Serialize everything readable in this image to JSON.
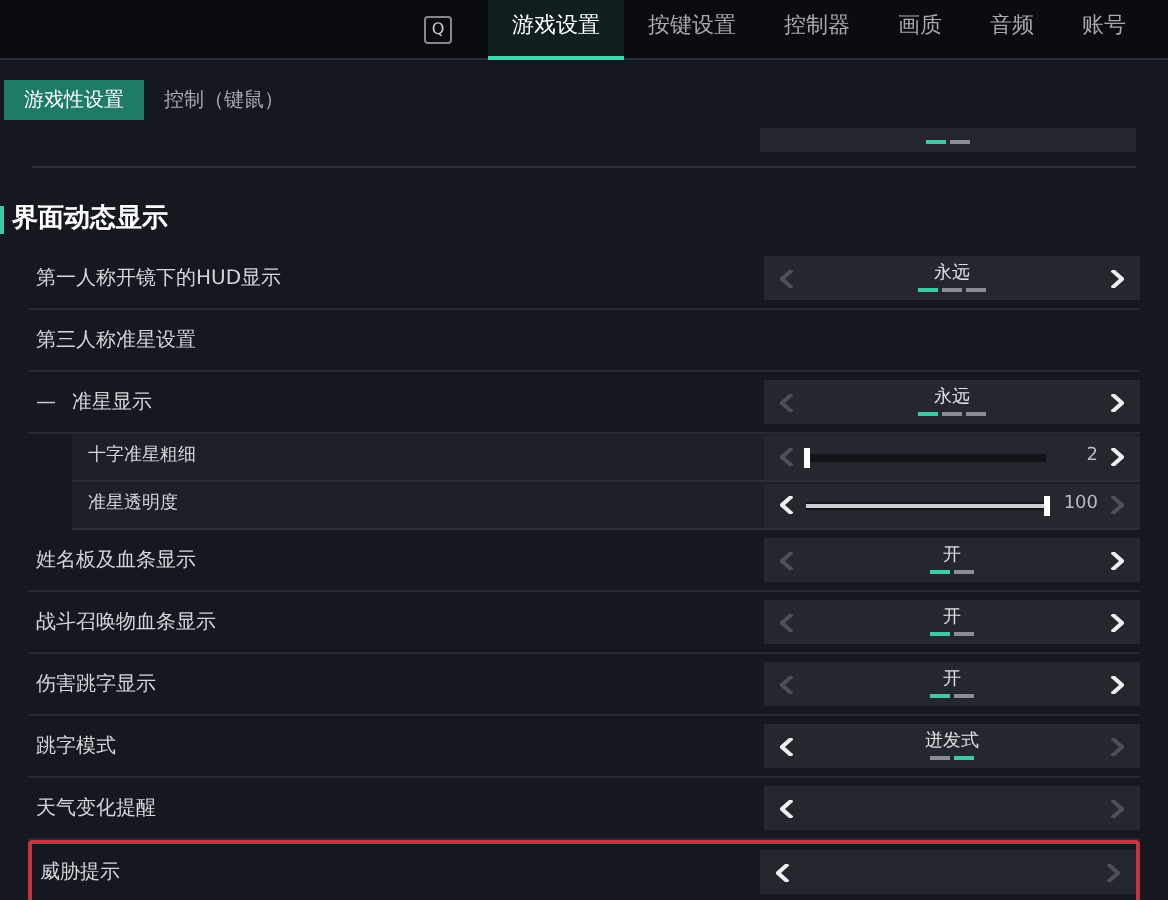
{
  "top_nav": {
    "left_key": "Q",
    "tabs": [
      {
        "label": "游戏设置",
        "selected": true
      },
      {
        "label": "按键设置",
        "selected": false
      },
      {
        "label": "控制器",
        "selected": false
      },
      {
        "label": "画质",
        "selected": false
      },
      {
        "label": "音频",
        "selected": false
      },
      {
        "label": "账号",
        "selected": false
      }
    ]
  },
  "sub_tabs": [
    {
      "label": "游戏性设置",
      "selected": true
    },
    {
      "label": "控制（键鼠）",
      "selected": false
    }
  ],
  "partial_row": {
    "segments": [
      {
        "selected": true
      },
      {
        "selected": false
      }
    ]
  },
  "section": {
    "title": "界面动态显示"
  },
  "rows": [
    {
      "kind": "selector",
      "label": "第一人称开镜下的HUD显示",
      "value": "永远",
      "prev_enabled": false,
      "next_enabled": true,
      "segments": [
        {
          "selected": true
        },
        {
          "selected": false
        },
        {
          "selected": false
        }
      ]
    },
    {
      "kind": "heading",
      "label": "第三人称准星设置"
    },
    {
      "kind": "selector",
      "label": "准星显示",
      "prefix": "—",
      "value": "永远",
      "prev_enabled": false,
      "next_enabled": true,
      "segments": [
        {
          "selected": true
        },
        {
          "selected": false
        },
        {
          "selected": false
        }
      ]
    },
    {
      "kind": "slider",
      "label": "十字准星粗细",
      "nested": true,
      "level": 0.0,
      "reading": "2",
      "prev_enabled": false,
      "next_enabled": true
    },
    {
      "kind": "slider",
      "label": "准星透明度",
      "nested": true,
      "level": 1.0,
      "reading": "100",
      "prev_enabled": true,
      "next_enabled": false
    },
    {
      "kind": "selector",
      "label": "姓名板及血条显示",
      "value": "开",
      "prev_enabled": false,
      "next_enabled": true,
      "segments": [
        {
          "selected": true
        },
        {
          "selected": false
        }
      ]
    },
    {
      "kind": "selector",
      "label": "战斗召唤物血条显示",
      "value": "开",
      "prev_enabled": false,
      "next_enabled": true,
      "segments": [
        {
          "selected": true
        },
        {
          "selected": false
        }
      ]
    },
    {
      "kind": "selector",
      "label": "伤害跳字显示",
      "value": "开",
      "prev_enabled": false,
      "next_enabled": true,
      "segments": [
        {
          "selected": true
        },
        {
          "selected": false
        }
      ]
    },
    {
      "kind": "selector",
      "label": "跳字模式",
      "value": "迸发式",
      "prev_enabled": true,
      "next_enabled": false,
      "segments": [
        {
          "selected": false
        },
        {
          "selected": true
        }
      ]
    },
    {
      "kind": "selector",
      "label": "天气变化提醒",
      "prev_enabled": true,
      "next_enabled": false
    },
    {
      "kind": "selector",
      "label": "威胁提示",
      "prev_enabled": true,
      "next_enabled": false,
      "highlighted": true
    }
  ]
}
